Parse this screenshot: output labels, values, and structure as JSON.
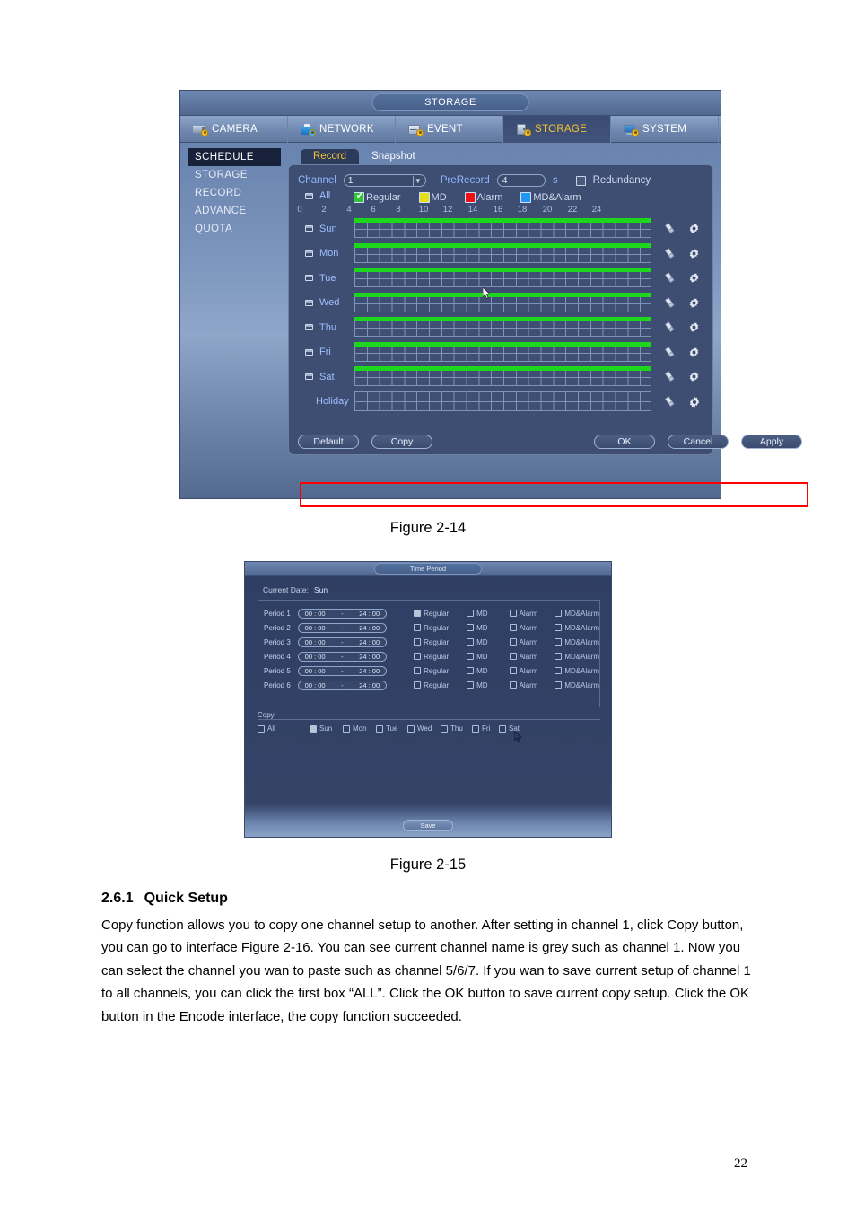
{
  "document": {
    "figure_14_caption": "Figure 2-14",
    "figure_15_caption": "Figure 2-15",
    "section_number": "2.6.1",
    "section_title": "Quick Setup",
    "body_paragraph": "Copy function allows you to copy one channel setup to another. After setting in channel 1, click Copy button, you can go to interface Figure 2-16. You can see current channel name is grey such as channel 1. Now you can select the channel you wan to paste such as channel 5/6/7. If you wan to save current setup of channel 1 to all channels, you can click the first box “ALL”. Click the OK button to save current copy setup. Click the OK button in the Encode interface, the copy function succeeded.",
    "page_number": "22"
  },
  "dvr": {
    "window_title": "STORAGE",
    "top_tabs": [
      {
        "label": "CAMERA",
        "icon": "camera-icon",
        "active": false
      },
      {
        "label": "NETWORK",
        "icon": "network-icon",
        "active": false
      },
      {
        "label": "EVENT",
        "icon": "event-icon",
        "active": false
      },
      {
        "label": "STORAGE",
        "icon": "storage-icon",
        "active": true
      },
      {
        "label": "SYSTEM",
        "icon": "system-icon",
        "active": false
      }
    ],
    "sidebar": [
      {
        "label": "SCHEDULE",
        "active": true
      },
      {
        "label": "STORAGE",
        "active": false
      },
      {
        "label": "RECORD",
        "active": false
      },
      {
        "label": "ADVANCE",
        "active": false
      },
      {
        "label": "QUOTA",
        "active": false
      }
    ],
    "sub_tabs": [
      {
        "label": "Record",
        "active": true
      },
      {
        "label": "Snapshot",
        "active": false
      }
    ],
    "controls": {
      "channel_label": "Channel",
      "channel_value": "1",
      "prerecord_label": "PreRecord",
      "prerecord_value": "4",
      "prerecord_unit": "s",
      "redundancy_label": "Redundancy",
      "redundancy_checked": false
    },
    "legend": [
      {
        "label": "Regular",
        "color": "#2fc72f",
        "checked": true
      },
      {
        "label": "MD",
        "color": "#e3e01a",
        "checked": false
      },
      {
        "label": "Alarm",
        "color": "#ef1111",
        "checked": false
      },
      {
        "label": "MD&Alarm",
        "color": "#2196f3",
        "checked": false
      }
    ],
    "hour_ticks": [
      "0",
      "2",
      "4",
      "6",
      "8",
      "10",
      "12",
      "14",
      "16",
      "18",
      "20",
      "22",
      "24"
    ],
    "rows": [
      {
        "label": "All",
        "checkbox": true,
        "recorded": false
      },
      {
        "label": "Sun",
        "checkbox": true,
        "recorded": true
      },
      {
        "label": "Mon",
        "checkbox": true,
        "recorded": true
      },
      {
        "label": "Tue",
        "checkbox": true,
        "recorded": true
      },
      {
        "label": "Wed",
        "checkbox": true,
        "recorded": true
      },
      {
        "label": "Thu",
        "checkbox": true,
        "recorded": true
      },
      {
        "label": "Fri",
        "checkbox": true,
        "recorded": true
      },
      {
        "label": "Sat",
        "checkbox": true,
        "recorded": true
      },
      {
        "label": "Holiday",
        "checkbox": false,
        "recorded": false
      }
    ],
    "row_icons": {
      "eraser": "eraser-icon",
      "setup": "gear-icon"
    },
    "buttons": {
      "default": "Default",
      "copy": "Copy",
      "ok": "OK",
      "cancel": "Cancel",
      "apply": "Apply"
    },
    "highlight_color": "#ff0000",
    "highlight_row": "Holiday"
  },
  "time_period": {
    "window_title": "Time Period",
    "current_date_label": "Current Date:",
    "current_date_value": "Sun",
    "period_rows": [
      {
        "label": "Period 1",
        "start": "00 : 00",
        "end": "24 : 00",
        "regular": true,
        "md": false,
        "alarm": false,
        "md_alarm": false
      },
      {
        "label": "Period 2",
        "start": "00 : 00",
        "end": "24 : 00",
        "regular": false,
        "md": false,
        "alarm": false,
        "md_alarm": false
      },
      {
        "label": "Period 3",
        "start": "00 : 00",
        "end": "24 : 00",
        "regular": false,
        "md": false,
        "alarm": false,
        "md_alarm": false
      },
      {
        "label": "Period 4",
        "start": "00 : 00",
        "end": "24 : 00",
        "regular": false,
        "md": false,
        "alarm": false,
        "md_alarm": false
      },
      {
        "label": "Period 5",
        "start": "00 : 00",
        "end": "24 : 00",
        "regular": false,
        "md": false,
        "alarm": false,
        "md_alarm": false
      },
      {
        "label": "Period 6",
        "start": "00 : 00",
        "end": "24 : 00",
        "regular": false,
        "md": false,
        "alarm": false,
        "md_alarm": false
      }
    ],
    "column_labels": {
      "regular": "Regular",
      "md": "MD",
      "alarm": "Alarm",
      "md_alarm": "MD&Alarm"
    },
    "copy_label": "Copy",
    "copy_days": [
      {
        "label": "All",
        "checked": false
      },
      {
        "label": "Sun",
        "checked": true
      },
      {
        "label": "Mon",
        "checked": false
      },
      {
        "label": "Tue",
        "checked": false
      },
      {
        "label": "Wed",
        "checked": false
      },
      {
        "label": "Thu",
        "checked": false
      },
      {
        "label": "Fri",
        "checked": false
      },
      {
        "label": "Sat",
        "checked": false
      }
    ],
    "save_label": "Save"
  }
}
